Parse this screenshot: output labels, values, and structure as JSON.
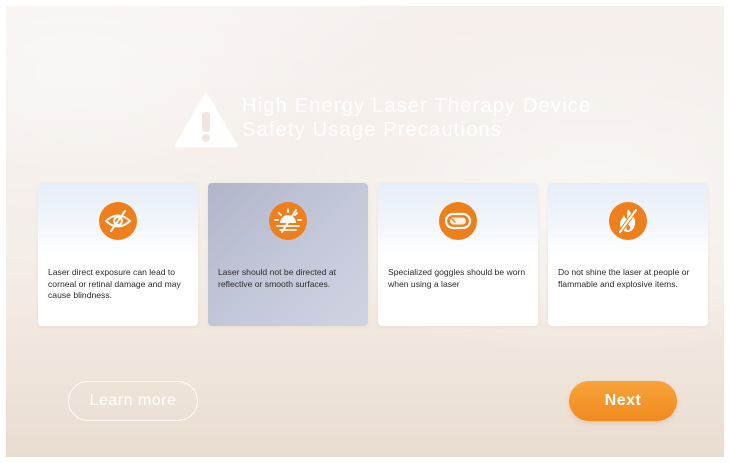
{
  "title": {
    "line1": "High Energy Laser Therapy Device",
    "line2": "Safety Usage Precautions"
  },
  "warning_icon": "warning-triangle-icon",
  "cards": [
    {
      "icon": "eye-slash-icon",
      "text": "Laser direct exposure can lead to corneal or retinal damage and may cause blindness.",
      "selected": false
    },
    {
      "icon": "sun-no-reflect-icon",
      "text": "Laser should not be directed at reflective or smooth surfaces.",
      "selected": true
    },
    {
      "icon": "goggles-icon",
      "text": "Specialized goggles should be worn when using a laser",
      "selected": false
    },
    {
      "icon": "no-fire-icon",
      "text": "Do not shine the laser at people or flammable and explosive items.",
      "selected": false
    }
  ],
  "buttons": {
    "learn_more": "Learn more",
    "next": "Next"
  },
  "colors": {
    "accent": "#f08a1e",
    "selected_card": "#c0c5d6"
  }
}
